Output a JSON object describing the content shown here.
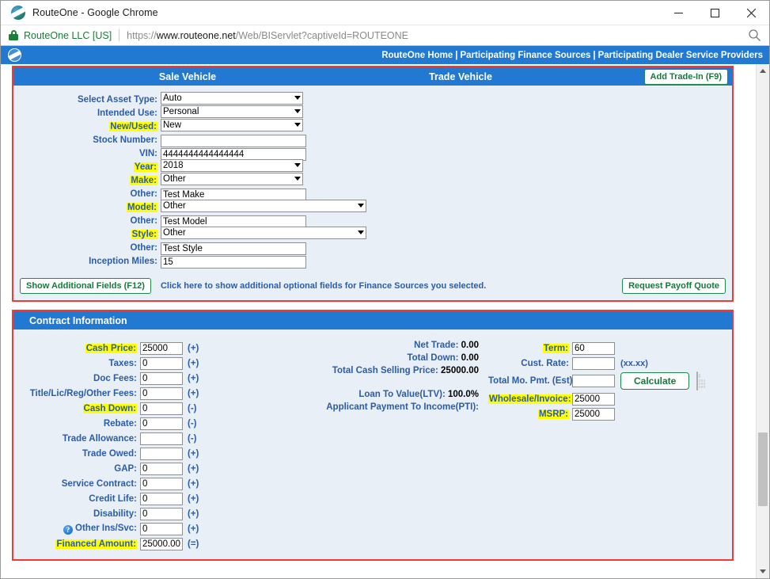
{
  "window": {
    "title": "RouteOne - Google Chrome",
    "minimize_label": "–",
    "maximize_label": "□",
    "close_label": "✕"
  },
  "browser": {
    "site_identity": "RouteOne LLC [US]",
    "url_scheme": "https://",
    "url_host": "www.routeone.net",
    "url_path": "/Web/BIServlet?captiveId=ROUTEONE",
    "lock_icon": "lock-icon",
    "zoom_icon": "search-icon"
  },
  "topnav": {
    "logo": "routeone-logo-icon",
    "links": [
      "RouteOne Home",
      "Participating Finance Sources",
      "Participating Dealer Service Providers"
    ],
    "separator": "|"
  },
  "vehicle_section": {
    "header": {
      "sale_vehicle": "Sale Vehicle",
      "trade_vehicle": "Trade Vehicle",
      "add_trade_in_button": "Add Trade-In (F9)"
    },
    "fields": [
      {
        "label": "Select Asset Type:",
        "highlight": false,
        "type": "select",
        "value": "Auto",
        "width": "sel"
      },
      {
        "label": "Intended Use:",
        "highlight": false,
        "type": "select",
        "value": "Personal",
        "width": "sel"
      },
      {
        "label": "New/Used:",
        "highlight": true,
        "type": "select",
        "value": "New",
        "width": "sel"
      },
      {
        "label": "Stock Number:",
        "highlight": false,
        "type": "text",
        "value": "",
        "width": "in"
      },
      {
        "label": "VIN:",
        "highlight": false,
        "type": "text",
        "value": "4444444444444444",
        "width": "in"
      },
      {
        "label": "Year:",
        "highlight": true,
        "type": "select",
        "value": "2018",
        "width": "sel"
      },
      {
        "label": "Make:",
        "highlight": true,
        "type": "select",
        "value": "Other",
        "width": "sel"
      },
      {
        "label": "Other:",
        "highlight": false,
        "type": "text",
        "value": "Test Make",
        "width": "in"
      },
      {
        "label": "Model:",
        "highlight": true,
        "type": "select",
        "value": "Other",
        "width": "selwide"
      },
      {
        "label": "Other:",
        "highlight": false,
        "type": "text",
        "value": "Test Model",
        "width": "in"
      },
      {
        "label": "Style:",
        "highlight": true,
        "type": "select",
        "value": "Other",
        "width": "selwide"
      },
      {
        "label": "Other:",
        "highlight": false,
        "type": "text",
        "value": "Test Style",
        "width": "in"
      },
      {
        "label": "Inception Miles:",
        "highlight": false,
        "type": "text",
        "value": "15",
        "width": "in"
      }
    ],
    "footer": {
      "show_additional_fields_button": "Show Additional Fields (F12)",
      "hint": "Click here to show additional optional fields for Finance Sources you selected.",
      "request_payoff_quote_button": "Request Payoff Quote"
    }
  },
  "contract_section": {
    "header": "Contract Information",
    "left_fields": [
      {
        "label": "Cash Price:",
        "highlight": true,
        "value": "25000",
        "sign": "(+)",
        "readonly": false,
        "help": false
      },
      {
        "label": "Taxes:",
        "highlight": false,
        "value": "0",
        "sign": "(+)",
        "readonly": false,
        "help": false
      },
      {
        "label": "Doc Fees:",
        "highlight": false,
        "value": "0",
        "sign": "(+)",
        "readonly": false,
        "help": false
      },
      {
        "label": "Title/Lic/Reg/Other Fees:",
        "highlight": false,
        "value": "0",
        "sign": "(+)",
        "readonly": false,
        "help": false
      },
      {
        "label": "Cash Down:",
        "highlight": true,
        "value": "0",
        "sign": "(-)",
        "readonly": false,
        "help": false
      },
      {
        "label": "Rebate:",
        "highlight": false,
        "value": "0",
        "sign": "(-)",
        "readonly": false,
        "help": false
      },
      {
        "label": "Trade Allowance:",
        "highlight": false,
        "value": "",
        "sign": "(-)",
        "readonly": false,
        "help": false
      },
      {
        "label": "Trade Owed:",
        "highlight": false,
        "value": "",
        "sign": "(+)",
        "readonly": false,
        "help": false
      },
      {
        "label": "GAP:",
        "highlight": false,
        "value": "0",
        "sign": "(+)",
        "readonly": false,
        "help": false
      },
      {
        "label": "Service Contract:",
        "highlight": false,
        "value": "0",
        "sign": "(+)",
        "readonly": false,
        "help": false
      },
      {
        "label": "Credit Life:",
        "highlight": false,
        "value": "0",
        "sign": "(+)",
        "readonly": false,
        "help": false
      },
      {
        "label": "Disability:",
        "highlight": false,
        "value": "0",
        "sign": "(+)",
        "readonly": false,
        "help": false
      },
      {
        "label": "Other Ins/Svc:",
        "highlight": false,
        "value": "0",
        "sign": "(+)",
        "readonly": false,
        "help": true
      },
      {
        "label": "Financed Amount:",
        "highlight": true,
        "value": "25000.00",
        "sign": "(=)",
        "readonly": true,
        "help": false
      }
    ],
    "summary": [
      {
        "label": "Net Trade:",
        "value": "0.00"
      },
      {
        "label": "Total Down:",
        "value": "0.00"
      },
      {
        "label": "Total Cash Selling Price:",
        "value": "25000.00"
      }
    ],
    "ratios": [
      {
        "label": "Loan To Value(LTV):",
        "value": "100.0%"
      },
      {
        "label": "Applicant Payment To Income(PTI):",
        "value": ""
      }
    ],
    "right_fields": [
      {
        "label": "Term:",
        "highlight": true,
        "value": "60",
        "hint": ""
      },
      {
        "label": "Cust. Rate:",
        "highlight": false,
        "value": "",
        "hint": "(xx.xx)"
      },
      {
        "label": "Total Mo. Pmt. (Est):",
        "highlight": false,
        "value": "",
        "hint": ""
      },
      {
        "label": "Wholesale/Invoice:",
        "highlight": true,
        "value": "25000",
        "hint": ""
      },
      {
        "label": "MSRP:",
        "highlight": true,
        "value": "25000",
        "hint": ""
      }
    ],
    "calculate_button": "Calculate",
    "calculator_icon": "calculator-icon"
  },
  "colors": {
    "header_blue": "#2279d2",
    "section_red": "#ef3a37",
    "label_blue": "#2b5ca8",
    "highlight_yellow": "#ffff00",
    "green_button": "#137a3c"
  }
}
